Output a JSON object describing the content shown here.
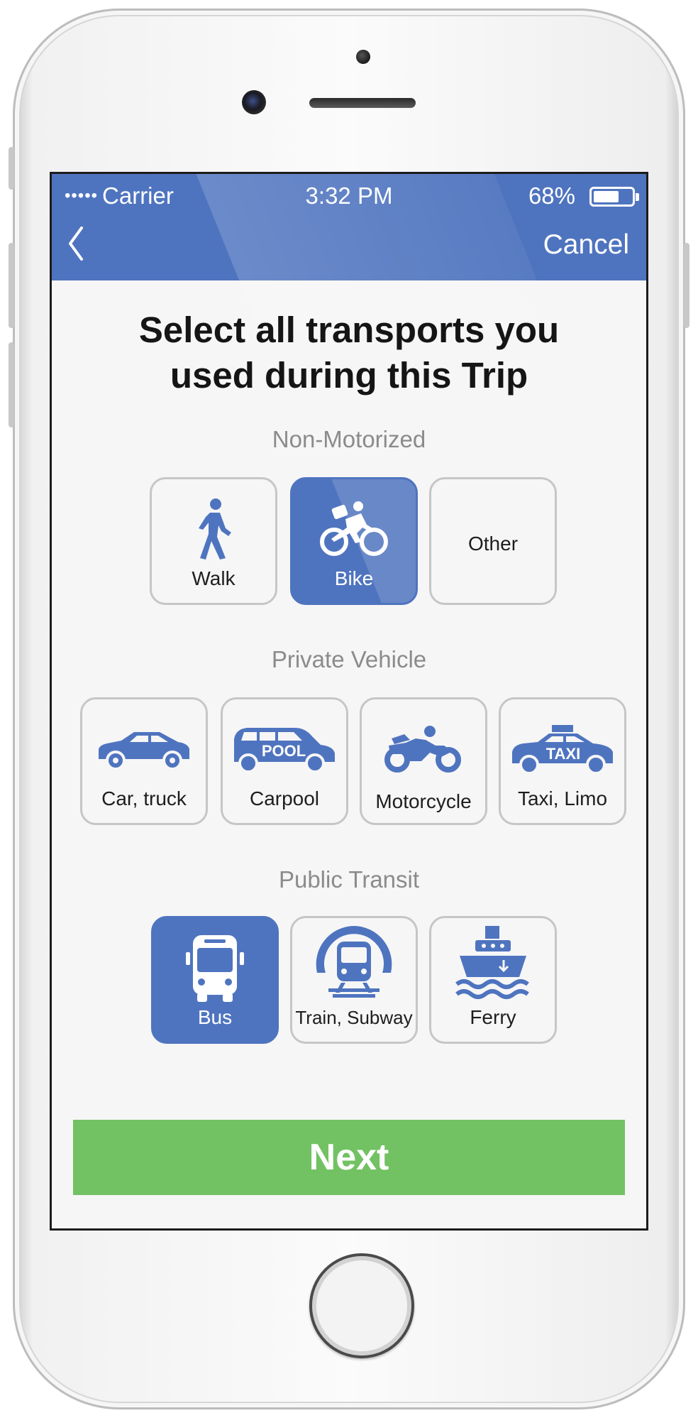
{
  "status_bar": {
    "signal_dots": "•••••",
    "carrier": "Carrier",
    "time": "3:32 PM",
    "battery_percent": "68%",
    "battery_level": 0.68
  },
  "nav": {
    "back_icon": "chevron-left-icon",
    "cancel_label": "Cancel"
  },
  "page": {
    "title_line1": "Select all transports you",
    "title_line2": "used during this Trip"
  },
  "sections": {
    "non_motorized": {
      "label": "Non-Motorized",
      "items": [
        {
          "label": "Walk",
          "icon": "walk-icon",
          "selected": false
        },
        {
          "label": "Bike",
          "icon": "bike-icon",
          "selected": true
        },
        {
          "label": "Other",
          "icon": "",
          "selected": false
        }
      ]
    },
    "private_vehicle": {
      "label": "Private Vehicle",
      "items": [
        {
          "label": "Car, truck",
          "icon": "car-icon",
          "selected": false
        },
        {
          "label": "Carpool",
          "icon": "carpool-icon",
          "icon_text": "POOL",
          "selected": false
        },
        {
          "label": "Motorcycle",
          "icon": "motorcycle-icon",
          "selected": false
        },
        {
          "label": "Taxi, Limo",
          "icon": "taxi-icon",
          "icon_text": "TAXI",
          "selected": false
        }
      ]
    },
    "public_transit": {
      "label": "Public Transit",
      "items": [
        {
          "label": "Bus",
          "icon": "bus-icon",
          "selected": true
        },
        {
          "label": "Train, Subway",
          "icon": "train-icon",
          "selected": false
        },
        {
          "label": "Ferry",
          "icon": "ferry-icon",
          "selected": false
        }
      ]
    }
  },
  "next_button": {
    "label": "Next"
  },
  "colors": {
    "brand_blue": "#4f74bf",
    "next_green": "#72c263",
    "tile_border": "#c6c6c6",
    "section_label": "#8b8b8b"
  }
}
